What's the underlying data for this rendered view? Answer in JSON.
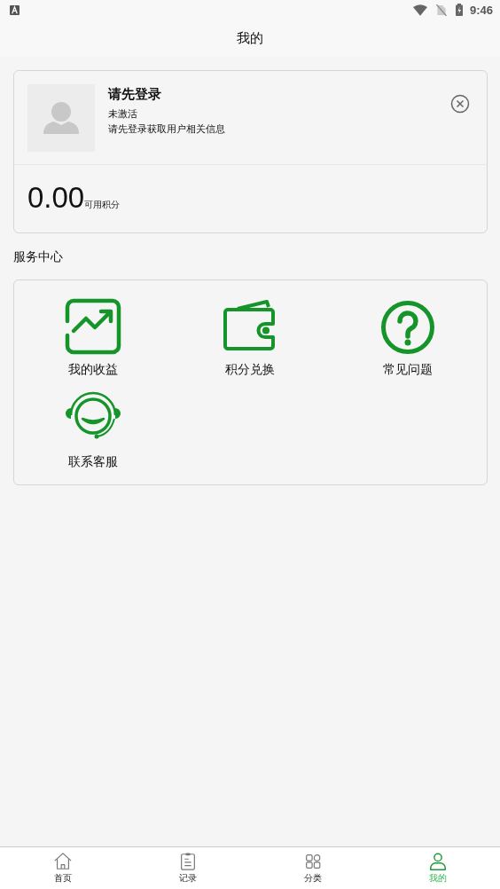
{
  "status_bar": {
    "time": "9:46"
  },
  "header": {
    "title": "我的"
  },
  "profile": {
    "name": "请先登录",
    "status": "未激活",
    "hint": "请先登录获取用户相关信息",
    "points": "0.00",
    "points_label": "可用积分"
  },
  "services": {
    "title": "服务中心",
    "items": [
      {
        "kind": "chart",
        "label": "我的收益"
      },
      {
        "kind": "wallet",
        "label": "积分兑换"
      },
      {
        "kind": "help",
        "label": "常见问题"
      },
      {
        "kind": "support",
        "label": "联系客服"
      }
    ]
  },
  "tabs": [
    {
      "kind": "home",
      "label": "首页",
      "selected": false
    },
    {
      "kind": "record",
      "label": "记录",
      "selected": false
    },
    {
      "kind": "grid",
      "label": "分类",
      "selected": false
    },
    {
      "kind": "user",
      "label": "我的",
      "selected": true
    }
  ]
}
